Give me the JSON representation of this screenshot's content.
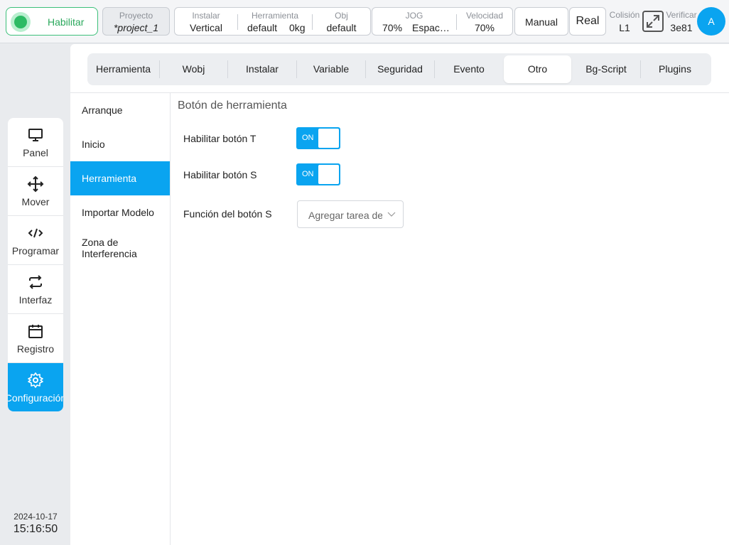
{
  "topbar": {
    "enable_label": "Habilitar",
    "project": {
      "caption": "Proyecto",
      "value": "*project_1"
    },
    "install": {
      "caption": "Instalar",
      "value": "Vertical"
    },
    "tool": {
      "caption": "Herramienta",
      "name": "default",
      "weight": "0kg"
    },
    "obj": {
      "caption": "Obj",
      "value": "default"
    },
    "jog": {
      "caption": "JOG",
      "speed": "70%",
      "space": "Espac…"
    },
    "velocity": {
      "caption": "Velocidad",
      "value": "70%"
    },
    "mode_label": "Manual",
    "real_label": "Real",
    "collision": {
      "caption": "Colisión",
      "value": "L1"
    },
    "verify": {
      "caption": "Verificar",
      "value": "3e81"
    },
    "avatar_letter": "A"
  },
  "nav": {
    "items": [
      {
        "label": "Panel",
        "icon": "monitor-icon"
      },
      {
        "label": "Mover",
        "icon": "move-icon"
      },
      {
        "label": "Programar",
        "icon": "code-icon"
      },
      {
        "label": "Interfaz",
        "icon": "swap-icon"
      },
      {
        "label": "Registro",
        "icon": "calendar-icon"
      },
      {
        "label": "Configuración",
        "icon": "gear-icon",
        "active": true
      }
    ]
  },
  "datetime": {
    "date": "2024-10-17",
    "time": "15:16:50"
  },
  "tabs": [
    {
      "label": "Herramienta"
    },
    {
      "label": "Wobj"
    },
    {
      "label": "Instalar"
    },
    {
      "label": "Variable"
    },
    {
      "label": "Seguridad"
    },
    {
      "label": "Evento"
    },
    {
      "label": "Otro",
      "active": true
    },
    {
      "label": "Bg-Script"
    },
    {
      "label": "Plugins"
    }
  ],
  "subnav": [
    {
      "label": "Arranque"
    },
    {
      "label": "Inicio"
    },
    {
      "label": "Herramienta",
      "active": true
    },
    {
      "label": "Importar Modelo"
    },
    {
      "label": "Zona de Interferencia"
    }
  ],
  "content": {
    "title": "Botón de herramienta",
    "toggle_t": {
      "label": "Habilitar botón T",
      "state": "ON"
    },
    "toggle_s": {
      "label": "Habilitar botón S",
      "state": "ON"
    },
    "s_function": {
      "label": "Función del botón S",
      "value": "Agregar tarea de"
    }
  },
  "colors": {
    "accent": "#0aa4f0",
    "enable_green": "#2dbb64"
  }
}
